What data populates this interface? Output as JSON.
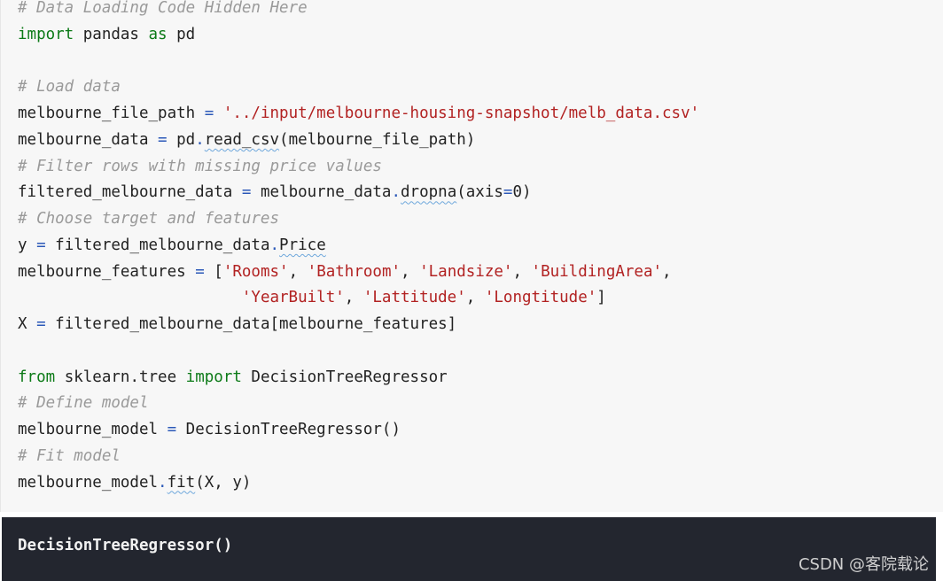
{
  "code": {
    "lines": [
      [
        {
          "t": "# Data Loading Code Hidden Here",
          "c": "comment"
        }
      ],
      [
        {
          "t": "import",
          "c": "keyword"
        },
        {
          "t": " pandas ",
          "c": "plain"
        },
        {
          "t": "as",
          "c": "keyword"
        },
        {
          "t": " pd",
          "c": "plain"
        }
      ],
      [],
      [
        {
          "t": "# Load data",
          "c": "comment"
        }
      ],
      [
        {
          "t": "melbourne_file_path ",
          "c": "plain"
        },
        {
          "t": "=",
          "c": "op"
        },
        {
          "t": " ",
          "c": "plain"
        },
        {
          "t": "'../input/melbourne-housing-snapshot/melb_data.csv'",
          "c": "string"
        }
      ],
      [
        {
          "t": "melbourne_data ",
          "c": "plain"
        },
        {
          "t": "=",
          "c": "op"
        },
        {
          "t": " pd",
          "c": "plain"
        },
        {
          "t": ".",
          "c": "op"
        },
        {
          "t": "read_csv",
          "c": "plain",
          "u": true
        },
        {
          "t": "(melbourne_file_path)",
          "c": "plain"
        }
      ],
      [
        {
          "t": "# Filter rows with missing price values",
          "c": "comment"
        }
      ],
      [
        {
          "t": "filtered_melbourne_data ",
          "c": "plain"
        },
        {
          "t": "=",
          "c": "op"
        },
        {
          "t": " melbourne_data",
          "c": "plain"
        },
        {
          "t": ".",
          "c": "op"
        },
        {
          "t": "dropna",
          "c": "plain",
          "u": true
        },
        {
          "t": "(axis",
          "c": "plain"
        },
        {
          "t": "=",
          "c": "op"
        },
        {
          "t": "0)",
          "c": "plain"
        }
      ],
      [
        {
          "t": "# Choose target and features",
          "c": "comment"
        }
      ],
      [
        {
          "t": "y ",
          "c": "plain"
        },
        {
          "t": "=",
          "c": "op"
        },
        {
          "t": " filtered_melbourne_data",
          "c": "plain"
        },
        {
          "t": ".",
          "c": "op"
        },
        {
          "t": "Price",
          "c": "plain",
          "u": true
        }
      ],
      [
        {
          "t": "melbourne_features ",
          "c": "plain"
        },
        {
          "t": "=",
          "c": "op"
        },
        {
          "t": " [",
          "c": "plain"
        },
        {
          "t": "'Rooms'",
          "c": "string"
        },
        {
          "t": ", ",
          "c": "plain"
        },
        {
          "t": "'Bathroom'",
          "c": "string"
        },
        {
          "t": ", ",
          "c": "plain"
        },
        {
          "t": "'Landsize'",
          "c": "string"
        },
        {
          "t": ", ",
          "c": "plain"
        },
        {
          "t": "'BuildingArea'",
          "c": "string"
        },
        {
          "t": ",",
          "c": "plain"
        }
      ],
      [
        {
          "t": "                        ",
          "c": "plain"
        },
        {
          "t": "'YearBuilt'",
          "c": "string"
        },
        {
          "t": ", ",
          "c": "plain"
        },
        {
          "t": "'Lattitude'",
          "c": "string"
        },
        {
          "t": ", ",
          "c": "plain"
        },
        {
          "t": "'Longtitude'",
          "c": "string"
        },
        {
          "t": "]",
          "c": "plain"
        }
      ],
      [
        {
          "t": "X ",
          "c": "plain"
        },
        {
          "t": "=",
          "c": "op"
        },
        {
          "t": " filtered_melbourne_data[melbourne_features]",
          "c": "plain"
        }
      ],
      [],
      [
        {
          "t": "from",
          "c": "keyword"
        },
        {
          "t": " sklearn.tree ",
          "c": "plain"
        },
        {
          "t": "import",
          "c": "keyword"
        },
        {
          "t": " DecisionTreeRegressor",
          "c": "plain"
        }
      ],
      [
        {
          "t": "# Define model",
          "c": "comment"
        }
      ],
      [
        {
          "t": "melbourne_model ",
          "c": "plain"
        },
        {
          "t": "=",
          "c": "op"
        },
        {
          "t": " DecisionTreeRegressor()",
          "c": "plain"
        }
      ],
      [
        {
          "t": "# Fit model",
          "c": "comment"
        }
      ],
      [
        {
          "t": "melbourne_model",
          "c": "plain"
        },
        {
          "t": ".",
          "c": "op"
        },
        {
          "t": "fit",
          "c": "plain",
          "u": true
        },
        {
          "t": "(X, y)",
          "c": "plain"
        }
      ]
    ]
  },
  "output": {
    "text": "DecisionTreeRegressor()"
  },
  "watermark": {
    "text": "CSDN @客院载论"
  },
  "colors": {
    "comment": "#9a9a9a",
    "keyword": "#0c7a17",
    "string": "#b22222",
    "operator": "#2b58b8",
    "output_background": "#23262f",
    "cell_background": "#f7f7f7"
  }
}
